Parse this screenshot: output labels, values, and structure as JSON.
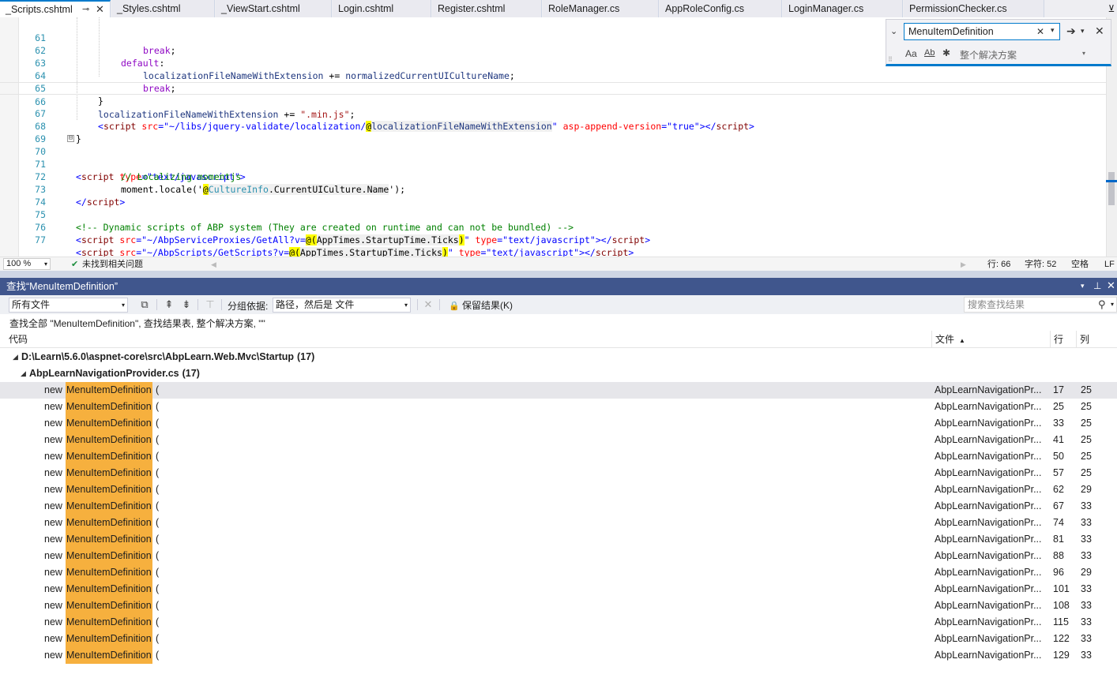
{
  "tabs": [
    {
      "label": "_Scripts.cshtml",
      "active": true
    },
    {
      "label": "_Styles.cshtml"
    },
    {
      "label": "_ViewStart.cshtml"
    },
    {
      "label": "Login.cshtml"
    },
    {
      "label": "Register.cshtml"
    },
    {
      "label": "RoleManager.cs"
    },
    {
      "label": "AppRoleConfig.cs"
    },
    {
      "label": "LoginManager.cs"
    },
    {
      "label": "PermissionChecker.cs"
    }
  ],
  "tab_pin_glyph": "⊸",
  "tab_close_glyph": "✕",
  "tab_overflow_glyph": "⊻",
  "editor": {
    "line_numbers": [
      "61",
      "62",
      "63",
      "64",
      "65",
      "66",
      "67",
      "68",
      "69",
      "70",
      "71",
      "72",
      "73",
      "74",
      "75",
      "76",
      "77"
    ],
    "current_line": "66",
    "fold_glyph": "⊟"
  },
  "find_widget": {
    "search_text": "MenuItemDefinition",
    "clear_glyph": "✕",
    "next_glyph": "➔",
    "close_glyph": "✕",
    "expand_glyph": "⌄",
    "case_label": "Aa",
    "word_label": "Ab",
    "regex_glyph": "✱",
    "scope": "整个解决方案"
  },
  "editor_status": {
    "zoom": "100 %",
    "issues_icon": "check-circle-icon",
    "issues_glyph": "✔",
    "issues_text": "未找到相关问题",
    "line": "行: 66",
    "char": "字符: 52",
    "whitespace": "空格",
    "eol": "LF"
  },
  "find_results": {
    "title": "查找“MenuItemDefinition”",
    "scope_filter": "所有文件",
    "group_by_label": "分组依据:",
    "group_by_value": "路径，然后是 文件",
    "keep_results": "保留结果(K)",
    "search_placeholder": "搜索查找结果",
    "summary": "查找全部 \"MenuItemDefinition\", 查找结果表, 整个解决方案, \"\"",
    "columns": {
      "code": "代码",
      "file": "文件",
      "line": "行",
      "col": "列"
    },
    "group": {
      "path": "D:\\Learn\\5.6.0\\aspnet-core\\src\\AbpLearn.Web.Mvc\\Startup",
      "count": "(17)"
    },
    "file_group": {
      "name": "AbpLearnNavigationProvider.cs",
      "count": "(17)"
    },
    "rows": [
      {
        "prefix": "new",
        "match": "MenuItemDefinition",
        "suffix": "(",
        "file": "AbpLearnNavigationPr...",
        "line": "17",
        "col": "25"
      },
      {
        "prefix": "new",
        "match": "MenuItemDefinition",
        "suffix": "(",
        "file": "AbpLearnNavigationPr...",
        "line": "25",
        "col": "25"
      },
      {
        "prefix": "new",
        "match": "MenuItemDefinition",
        "suffix": "(",
        "file": "AbpLearnNavigationPr...",
        "line": "33",
        "col": "25"
      },
      {
        "prefix": "new",
        "match": "MenuItemDefinition",
        "suffix": "(",
        "file": "AbpLearnNavigationPr...",
        "line": "41",
        "col": "25"
      },
      {
        "prefix": "new",
        "match": "MenuItemDefinition",
        "suffix": "(",
        "file": "AbpLearnNavigationPr...",
        "line": "50",
        "col": "25"
      },
      {
        "prefix": "new",
        "match": "MenuItemDefinition",
        "suffix": "(",
        "file": "AbpLearnNavigationPr...",
        "line": "57",
        "col": "25"
      },
      {
        "prefix": "new",
        "match": "MenuItemDefinition",
        "suffix": "(",
        "file": "AbpLearnNavigationPr...",
        "line": "62",
        "col": "29"
      },
      {
        "prefix": "new",
        "match": "MenuItemDefinition",
        "suffix": "(",
        "file": "AbpLearnNavigationPr...",
        "line": "67",
        "col": "33"
      },
      {
        "prefix": "new",
        "match": "MenuItemDefinition",
        "suffix": "(",
        "file": "AbpLearnNavigationPr...",
        "line": "74",
        "col": "33"
      },
      {
        "prefix": "new",
        "match": "MenuItemDefinition",
        "suffix": "(",
        "file": "AbpLearnNavigationPr...",
        "line": "81",
        "col": "33"
      },
      {
        "prefix": "new",
        "match": "MenuItemDefinition",
        "suffix": "(",
        "file": "AbpLearnNavigationPr...",
        "line": "88",
        "col": "33"
      },
      {
        "prefix": "new",
        "match": "MenuItemDefinition",
        "suffix": "(",
        "file": "AbpLearnNavigationPr...",
        "line": "96",
        "col": "29"
      },
      {
        "prefix": "new",
        "match": "MenuItemDefinition",
        "suffix": "(",
        "file": "AbpLearnNavigationPr...",
        "line": "101",
        "col": "33"
      },
      {
        "prefix": "new",
        "match": "MenuItemDefinition",
        "suffix": "(",
        "file": "AbpLearnNavigationPr...",
        "line": "108",
        "col": "33"
      },
      {
        "prefix": "new",
        "match": "MenuItemDefinition",
        "suffix": "(",
        "file": "AbpLearnNavigationPr...",
        "line": "115",
        "col": "33"
      },
      {
        "prefix": "new",
        "match": "MenuItemDefinition",
        "suffix": "(",
        "file": "AbpLearnNavigationPr...",
        "line": "122",
        "col": "33"
      },
      {
        "prefix": "new",
        "match": "MenuItemDefinition",
        "suffix": "(",
        "file": "AbpLearnNavigationPr...",
        "line": "129",
        "col": "33"
      }
    ]
  },
  "code": {
    "l61": {
      "t1": "break",
      "t2": ";"
    },
    "l62": {
      "t1": "default",
      "t2": ":"
    },
    "l63": {
      "t1": "localizationFileNameWithExtension",
      "t2": " += ",
      "t3": "normalizedCurrentUICultureName",
      "t4": ";"
    },
    "l64": {
      "t1": "break",
      "t2": ";"
    },
    "l65": {
      "t1": "}"
    },
    "l66": {
      "t1": "localizationFileNameWithExtension",
      "t2": " += ",
      "t3": "\".min.js\"",
      "t4": ";"
    },
    "l67": {
      "t1": "<",
      "t2": "script",
      "t3": " src",
      "t4": "=",
      "t5": "\"~/libs/jquery-validate/localization/",
      "t6": "@",
      "t7": "localizationFileNameWithExtension",
      "t8": "\"",
      "t9": " asp-append-version",
      "t10": "=",
      "t11": "\"true\"",
      "t12": "></",
      "t13": "script",
      "t14": ">"
    },
    "l68": {
      "t1": "}"
    },
    "l70": {
      "t1": "<",
      "t2": "script",
      "t3": " type",
      "t4": "=",
      "t5": "\"text/javascript\"",
      "t6": ">"
    },
    "l71": {
      "t1": "// Localizing momentjs"
    },
    "l72": {
      "t1": "moment.locale('",
      "t2": "@",
      "t3": "CultureInfo",
      "t4": ".CurrentUICulture.Name",
      "t5": "');"
    },
    "l73": {
      "t1": "</",
      "t2": "script",
      "t3": ">"
    },
    "l75": {
      "t1": "<!-- Dynamic scripts of ABP system (They are created on runtime and can not be bundled) -->"
    },
    "l76": {
      "t1": "<",
      "t2": "script",
      "t3": " src",
      "t4": "=",
      "t5": "\"~/AbpServiceProxies/GetAll?v=",
      "t6": "@(",
      "t7": "AppTimes.StartupTime.Ticks",
      "t8": ")",
      "t9": "\"",
      "t10": " type",
      "t11": "=",
      "t12": "\"text/javascript\"",
      "t13": "></",
      "t14": "script",
      "t15": ">"
    },
    "l77": {
      "t1": "<",
      "t2": "script",
      "t3": " src",
      "t4": "=",
      "t5": "\"~/AbpScripts/GetScripts?v=",
      "t6": "@(",
      "t7": "AppTimes.StartupTime.Ticks",
      "t8": ")",
      "t9": "\"",
      "t10": " type",
      "t11": "=",
      "t12": "\"text/javascript\"",
      "t13": "></",
      "t14": "script",
      "t15": ">"
    }
  },
  "toolbar_icons": {
    "copy": "⧉",
    "prev": "⇞",
    "next": "⇟",
    "filter": "⊤",
    "clear": "✕",
    "lock": "🔒",
    "search": "⚲",
    "dropdown": "▾"
  },
  "titlebar_icons": {
    "dropdown": "▾",
    "pin": "⊥",
    "close": "✕"
  },
  "tree_icons": {
    "expanded": "◢",
    "sort_up": "▲"
  }
}
